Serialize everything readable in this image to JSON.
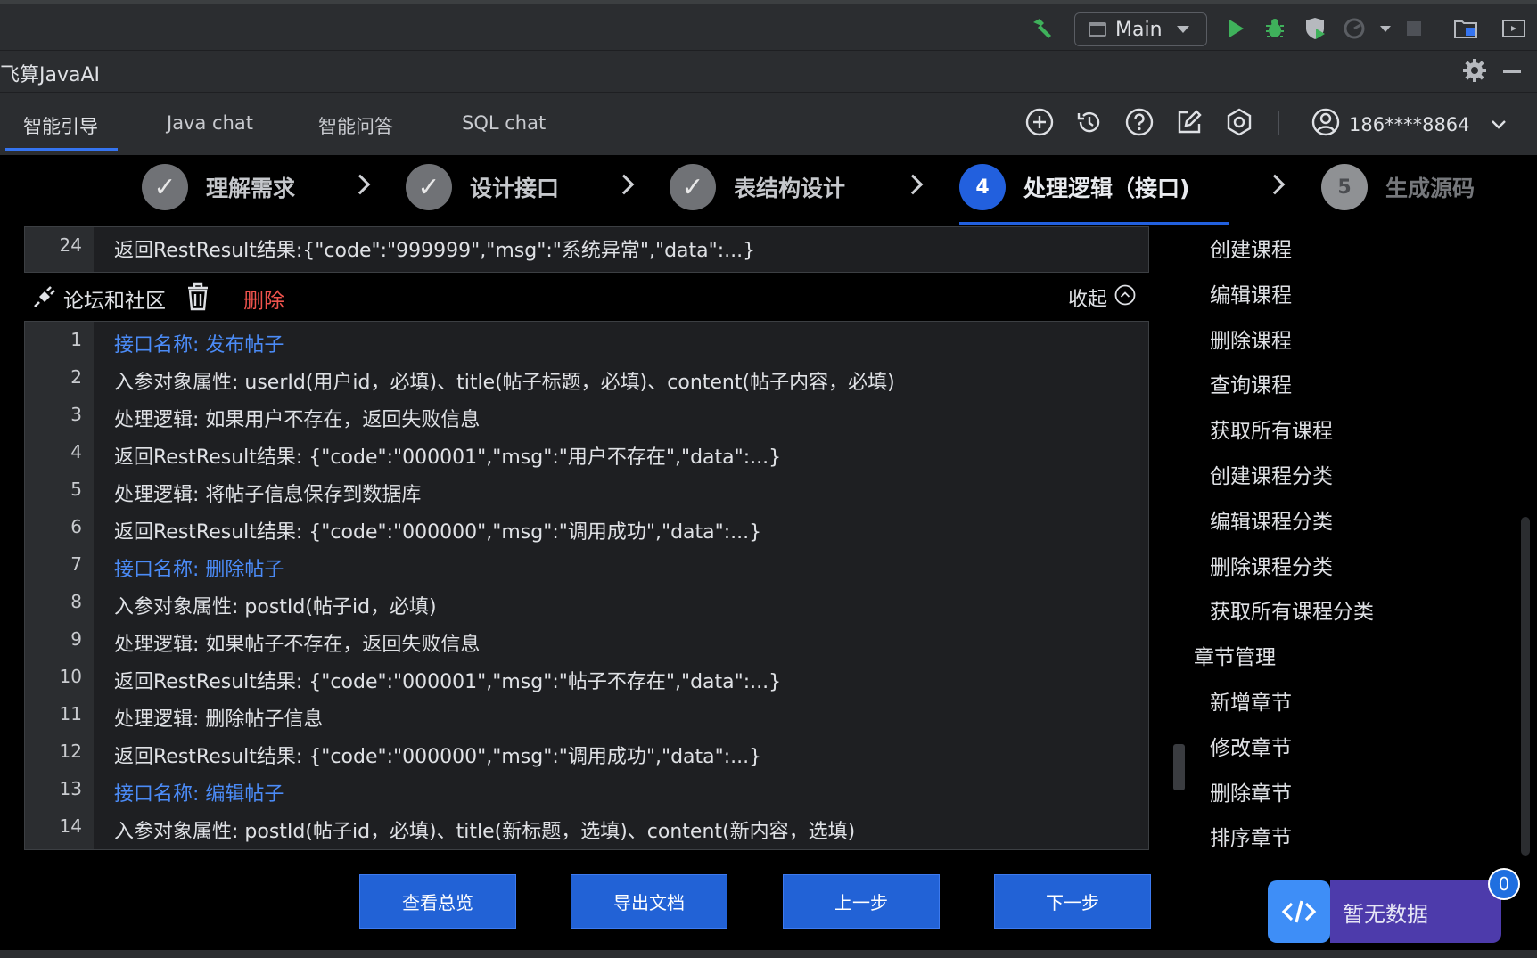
{
  "toolbar": {
    "run_config": "Main",
    "colors": {
      "hammer": "#3fb15b",
      "run": "#3fb15b",
      "debug": "#3fb15b"
    }
  },
  "tool_window": {
    "title": "飞算JavaAI"
  },
  "tabs": [
    {
      "label": "智能引导",
      "active": true
    },
    {
      "label": "Java chat"
    },
    {
      "label": "智能问答"
    },
    {
      "label": "SQL chat"
    }
  ],
  "header_icons": [
    "add-icon",
    "history-icon",
    "help-icon",
    "edit-icon",
    "settings-icon"
  ],
  "user": {
    "phone": "186****8864"
  },
  "steps": [
    {
      "num": "✓",
      "label": "理解需求",
      "state": "done"
    },
    {
      "num": "✓",
      "label": "设计接口",
      "state": "done"
    },
    {
      "num": "✓",
      "label": "表结构设计",
      "state": "done"
    },
    {
      "num": "4",
      "label": "处理逻辑（接口)",
      "state": "active"
    },
    {
      "num": "5",
      "label": "生成源码",
      "state": "todo"
    }
  ],
  "top_block": {
    "lines": [
      {
        "n": "24",
        "text": "返回RestResult结果:{\"code\":\"999999\",\"msg\":\"系统异常\",\"data\":...}"
      }
    ]
  },
  "section": {
    "title": "论坛和社区",
    "delete_label": "删除",
    "collapse_label": "收起"
  },
  "code": {
    "lines": [
      {
        "n": "1",
        "text": "接口名称: 发布帖子",
        "hl": true
      },
      {
        "n": "2",
        "text": "入参对象属性: userId(用户id，必填)、title(帖子标题，必填)、content(帖子内容，必填)"
      },
      {
        "n": "3",
        "text": "处理逻辑: 如果用户不存在，返回失败信息"
      },
      {
        "n": "4",
        "text": "返回RestResult结果: {\"code\":\"000001\",\"msg\":\"用户不存在\",\"data\":...}"
      },
      {
        "n": "5",
        "text": "处理逻辑: 将帖子信息保存到数据库"
      },
      {
        "n": "6",
        "text": "返回RestResult结果: {\"code\":\"000000\",\"msg\":\"调用成功\",\"data\":...}"
      },
      {
        "n": "7",
        "text": "接口名称: 删除帖子",
        "hl": true
      },
      {
        "n": "8",
        "text": "入参对象属性: postId(帖子id，必填)"
      },
      {
        "n": "9",
        "text": "处理逻辑: 如果帖子不存在，返回失败信息"
      },
      {
        "n": "10",
        "text": "返回RestResult结果: {\"code\":\"000001\",\"msg\":\"帖子不存在\",\"data\":...}"
      },
      {
        "n": "11",
        "text": "处理逻辑: 删除帖子信息"
      },
      {
        "n": "12",
        "text": "返回RestResult结果: {\"code\":\"000000\",\"msg\":\"调用成功\",\"data\":...}"
      },
      {
        "n": "13",
        "text": "接口名称: 编辑帖子",
        "hl": true
      },
      {
        "n": "14",
        "text": "入参对象属性: postId(帖子id，必填)、title(新标题，选填)、content(新内容，选填)"
      }
    ]
  },
  "buttons": {
    "overview": "查看总览",
    "export": "导出文档",
    "prev": "上一步",
    "next": "下一步"
  },
  "sidebar": {
    "items": [
      {
        "label": "创建课程",
        "level": 2
      },
      {
        "label": "编辑课程",
        "level": 2
      },
      {
        "label": "删除课程",
        "level": 2
      },
      {
        "label": "查询课程",
        "level": 2
      },
      {
        "label": "获取所有课程",
        "level": 2
      },
      {
        "label": "创建课程分类",
        "level": 2
      },
      {
        "label": "编辑课程分类",
        "level": 2
      },
      {
        "label": "删除课程分类",
        "level": 2
      },
      {
        "label": "获取所有课程分类",
        "level": 2
      },
      {
        "label": "章节管理",
        "level": 1
      },
      {
        "label": "新增章节",
        "level": 2
      },
      {
        "label": "修改章节",
        "level": 2
      },
      {
        "label": "删除章节",
        "level": 2
      },
      {
        "label": "排序章节",
        "level": 2
      }
    ]
  },
  "float_widget": {
    "label": "暂无数据",
    "badge": "0"
  },
  "colors": {
    "accent": "#2260de",
    "link": "#4b8bf7",
    "danger": "#f0534d",
    "widget": "#4d3bab"
  }
}
